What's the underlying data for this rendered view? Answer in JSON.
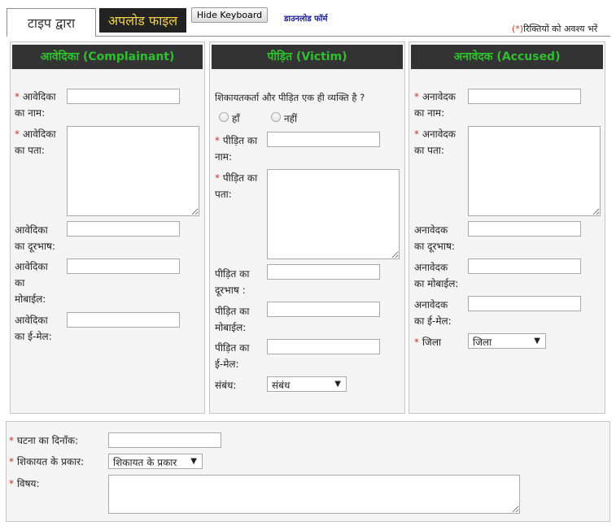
{
  "tabs": {
    "type_tab": "टाइप द्वारा",
    "upload_tab": "अपलोड फाइल",
    "hide_keyboard": "Hide Keyboard",
    "download_form": "डाउनलोड फॉर्म",
    "required_star": "(*)",
    "required_text": "रिक्तियों को अवश्य भरें"
  },
  "complainant": {
    "title": "आवेदिका (Complainant)",
    "name_l1": "आवेदिका",
    "name_l2": "का नाम:",
    "address_l1": "आवेदिका",
    "address_l2": "का पता:",
    "phone_l1": "आवेदिका",
    "phone_l2": "का दूरभाष:",
    "mobile_l1": "आवेदिका",
    "mobile_l2": "का",
    "mobile_l3": "मोबाईल:",
    "email_l1": "आवेदिका",
    "email_l2": "का ई-मेल:"
  },
  "victim": {
    "title": "पीड़ित (Victim)",
    "same_question": "शिकायतकर्ता और पीड़ित एक ही व्यक्ति है ?",
    "yes": "हाँ",
    "no": "नहीं",
    "name_l1": "पीड़ित का",
    "name_l2": "नाम:",
    "address_l1": "पीड़ित का",
    "address_l2": "पता:",
    "phone_l1": "पीड़ित का",
    "phone_l2": "दूरभाष :",
    "mobile_l1": "पीड़ित का",
    "mobile_l2": "मोबाईल:",
    "email_l1": "पीड़ित का",
    "email_l2": "ई-मेल:",
    "relation_label": "संबंध:",
    "relation_value": "संबंध"
  },
  "accused": {
    "title": "अनावेदक (Accused)",
    "name_l1": "अनावेदक",
    "name_l2": "का नाम:",
    "address_l1": "अनावेदक",
    "address_l2": "का पता:",
    "phone_l1": "अनावेदक",
    "phone_l2": "का दूरभाष:",
    "mobile_l1": "अनावेदक",
    "mobile_l2": "का मोबाईल:",
    "email_l1": "अनावेदक",
    "email_l2": "का ई-मेल:",
    "district_label": "जिला",
    "district_value": "जिला"
  },
  "incident": {
    "date_label": "घटना का दिनाँक:",
    "type_label": "शिकायत के प्रकार:",
    "type_value": "शिकायत के प्रकार",
    "subject_label": "विषय:"
  },
  "symbols": {
    "star": "*",
    "dropdown_arrow": "▼"
  }
}
